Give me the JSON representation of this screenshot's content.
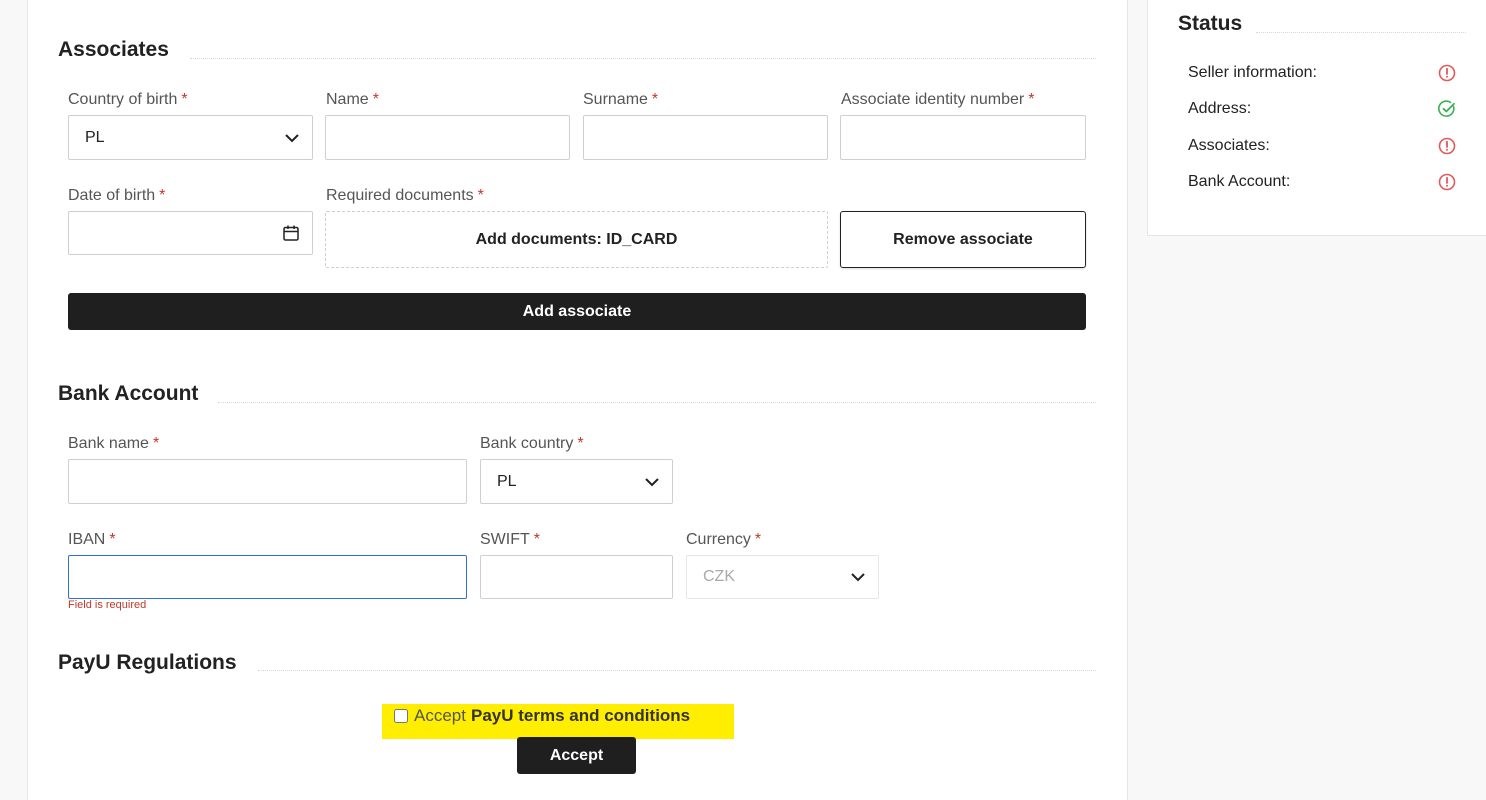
{
  "associates": {
    "title": "Associates",
    "country_of_birth": {
      "label": "Country of birth",
      "required": "*",
      "value": "PL"
    },
    "name": {
      "label": "Name",
      "required": "*",
      "value": ""
    },
    "surname": {
      "label": "Surname",
      "required": "*",
      "value": ""
    },
    "identity_number": {
      "label": "Associate identity number",
      "required": "*",
      "value": ""
    },
    "date_of_birth": {
      "label": "Date of birth",
      "required": "*",
      "value": ""
    },
    "required_documents": {
      "label": "Required documents",
      "required": "*",
      "button": "Add documents: ID_CARD"
    },
    "remove_button": "Remove associate",
    "add_button": "Add associate"
  },
  "bank_account": {
    "title": "Bank Account",
    "bank_name": {
      "label": "Bank name",
      "required": "*",
      "value": ""
    },
    "bank_country": {
      "label": "Bank country",
      "required": "*",
      "value": "PL"
    },
    "iban": {
      "label": "IBAN",
      "required": "*",
      "value": "",
      "error": "Field is required"
    },
    "swift": {
      "label": "SWIFT",
      "required": "*",
      "value": ""
    },
    "currency": {
      "label": "Currency",
      "required": "*",
      "value": "CZK"
    }
  },
  "regulations": {
    "title": "PayU Regulations",
    "accept_prefix": "Accept",
    "accept_link": "PayU terms and conditions",
    "accept_button": "Accept",
    "highlight_color": "#ffee00"
  },
  "status": {
    "title": "Status",
    "items": [
      {
        "label": "Seller information:",
        "state": "error",
        "icon": "alert-circle-icon"
      },
      {
        "label": "Address:",
        "state": "ok",
        "icon": "check-circle-icon"
      },
      {
        "label": "Associates:",
        "state": "error",
        "icon": "alert-circle-icon"
      },
      {
        "label": "Bank Account:",
        "state": "error",
        "icon": "alert-circle-icon"
      }
    ],
    "colors": {
      "error": "#e05a5a",
      "ok": "#3cb054"
    }
  }
}
